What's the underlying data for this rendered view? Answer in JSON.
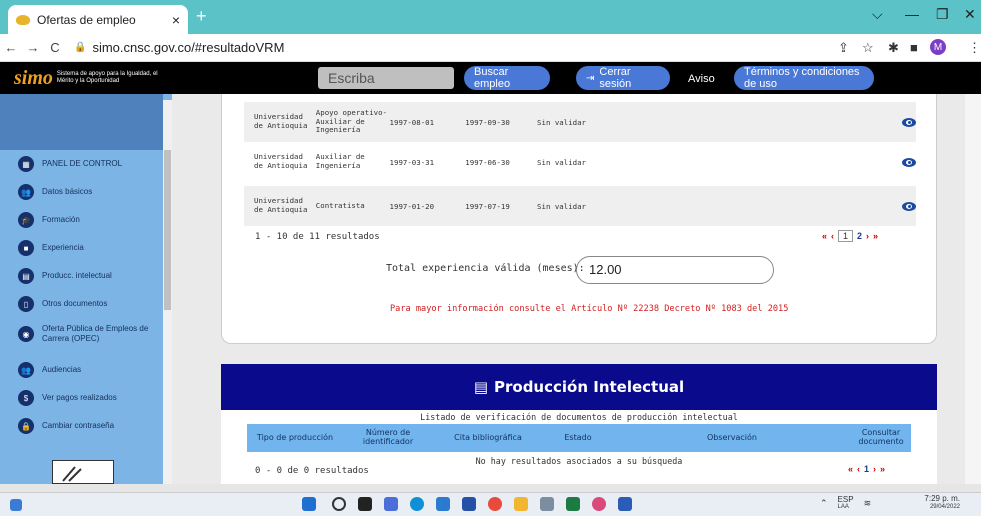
{
  "browser": {
    "tab_title": "Ofertas de empleo",
    "tab_close": "×",
    "new_tab": "+",
    "url": "simo.cnsc.gov.co/#resultadoVRM",
    "profile_initial": "M",
    "nav_back": "←",
    "nav_forward": "→",
    "nav_reload": "C"
  },
  "header": {
    "logo_text": "simo",
    "slogan": "Sistema de apoyo para la Igualdad, el Mérito y la Oportunidad",
    "search_placeholder": "Escriba",
    "buscar_label": "Buscar empleo",
    "cerrar_label": "Cerrar sesión",
    "aviso_label": "Aviso",
    "terminos_label": "Términos y condiciones de uso"
  },
  "sidebar": {
    "items": [
      {
        "label": "PANEL DE CONTROL",
        "icon": "grid-icon",
        "glyph": "▦"
      },
      {
        "label": "Datos básicos",
        "icon": "users-icon",
        "glyph": "👥"
      },
      {
        "label": "Formación",
        "icon": "graduation-icon",
        "glyph": "🎓"
      },
      {
        "label": "Experiencia",
        "icon": "briefcase-icon",
        "glyph": "■"
      },
      {
        "label": "Producc. intelectual",
        "icon": "book-icon",
        "glyph": "▤"
      },
      {
        "label": "Otros documentos",
        "icon": "document-icon",
        "glyph": "▯"
      },
      {
        "label": "Oferta Pública de Empleos de Carrera (OPEC)",
        "icon": "globe-icon",
        "glyph": "◉"
      },
      {
        "label": "Audiencias",
        "icon": "audience-icon",
        "glyph": "👥"
      },
      {
        "label": "Ver pagos realizados",
        "icon": "dollar-icon",
        "glyph": "$"
      },
      {
        "label": "Cambiar contraseña",
        "icon": "lock-icon",
        "glyph": "🔒"
      }
    ]
  },
  "experience": {
    "rows": [
      {
        "entidad": "Universidad de Antioquia",
        "cargo": "Apoyo operativo- Auxiliar de Ingeniería",
        "inicio": "1997-08-01",
        "fin": "1997-09-30",
        "estado": "Sin validar"
      },
      {
        "entidad": "Universidad de Antioquia",
        "cargo": "Auxiliar de Ingeniería",
        "inicio": "1997-03-31",
        "fin": "1997-06-30",
        "estado": "Sin validar"
      },
      {
        "entidad": "Universidad de Antioquia",
        "cargo": "Contratista",
        "inicio": "1997-01-20",
        "fin": "1997-07-19",
        "estado": "Sin validar"
      }
    ],
    "page_info": "1 - 10 de 11 resultados",
    "pager": {
      "first": "«",
      "prev": "‹",
      "current": "1",
      "next_page": "2",
      "next": "›",
      "last": "»"
    },
    "total_label": "Total experiencia válida (meses):",
    "total_value": "12.00",
    "note": "Para mayor información consulte el Artículo Nº 22238 Decreto Nº 1083 del 2015"
  },
  "produccion": {
    "title": "Producción Intelectual",
    "list_title": "Listado de verificación de documentos de producción intelectual",
    "columns": [
      "Tipo de producción",
      "Número de identificador",
      "Cita bibliográfica",
      "Estado",
      "Observación",
      "Consultar documento"
    ],
    "no_results": "No hay resultados asociados a su búsqueda",
    "page_info": "0 - 0 de 0 resultados",
    "pager": {
      "first": "«",
      "prev": "‹",
      "current": "1",
      "next": "›",
      "last": "»"
    }
  },
  "taskbar": {
    "lang": "ESP",
    "lang2": "LAA",
    "time": "7:29 p. m.",
    "date": "29/04/2022"
  },
  "colors": {
    "accent_header": "#0a0a8c",
    "button_blue": "#4a78d6",
    "sidebar": "#7cb4e6",
    "note_red": "#d02020"
  }
}
